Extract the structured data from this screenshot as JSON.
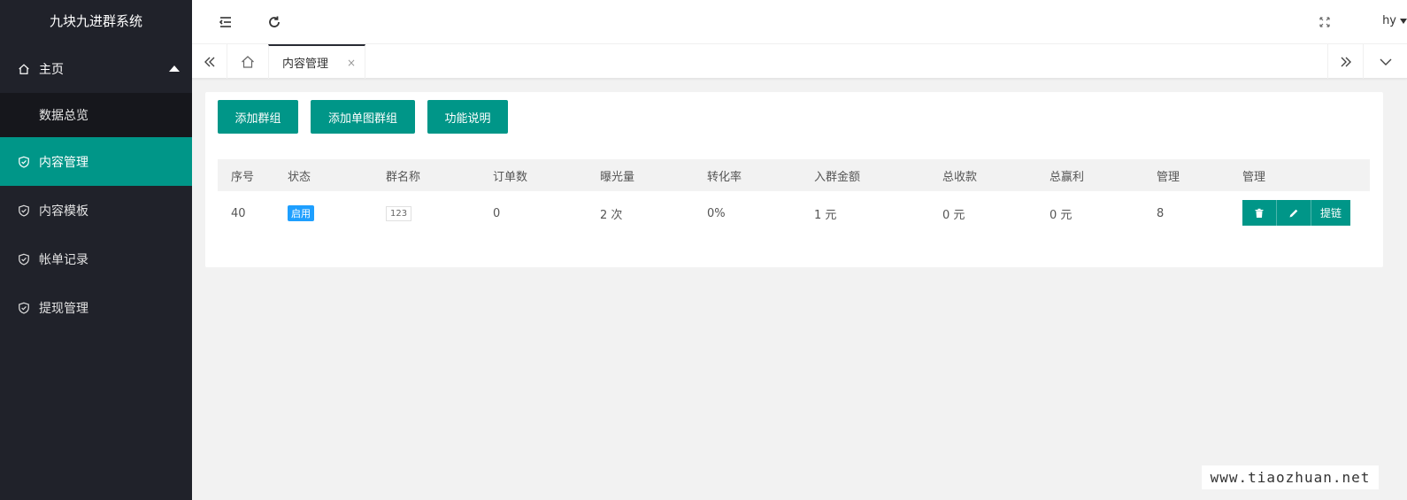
{
  "app": {
    "title": "九块九进群系统"
  },
  "sidebar": {
    "items": [
      {
        "label": "主页",
        "icon": "home-icon"
      },
      {
        "label": "数据总览"
      },
      {
        "label": "内容管理",
        "icon": "shield-icon"
      },
      {
        "label": "内容模板",
        "icon": "shield-icon"
      },
      {
        "label": "帐单记录",
        "icon": "shield-icon"
      },
      {
        "label": "提现管理",
        "icon": "shield-icon"
      }
    ]
  },
  "header": {
    "user": "hy"
  },
  "tabs": {
    "current": "内容管理",
    "close": "×"
  },
  "toolbar": {
    "add_group": "添加群组",
    "add_single": "添加单图群组",
    "help": "功能说明"
  },
  "table": {
    "columns": [
      "序号",
      "状态",
      "群名称",
      "订单数",
      "曝光量",
      "转化率",
      "入群金额",
      "总收款",
      "总赢利",
      "管理",
      "管理"
    ],
    "rows": [
      {
        "id": "40",
        "status": "启用",
        "name": "123",
        "orders": "0",
        "views": "2 次",
        "rate": "0%",
        "price": "1 元",
        "income": "0 元",
        "profit": "0 元",
        "manage": "8",
        "link_label": "提链"
      }
    ]
  },
  "colors": {
    "sidebar_bg": "#20222a",
    "accent": "#009688",
    "badge": "#1e9fff"
  },
  "watermark": "www.tiaozhuan.net"
}
